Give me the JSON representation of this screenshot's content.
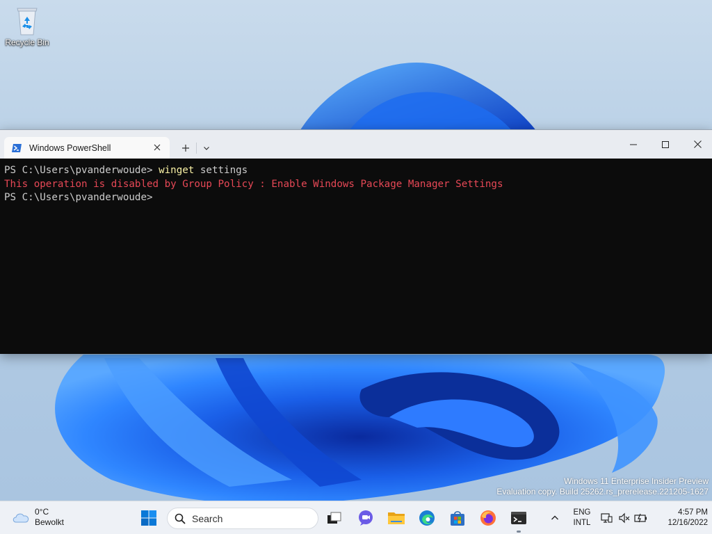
{
  "desktop": {
    "icons": [
      {
        "label": "Recycle Bin",
        "icon": "recycle-bin-icon"
      }
    ]
  },
  "window": {
    "tab_title": "Windows PowerShell",
    "tab_icon": "powershell-icon"
  },
  "console": {
    "lines": [
      {
        "prompt": "PS C:\\Users\\pvanderwoude> ",
        "command": "winget",
        "args": " settings"
      },
      {
        "error": "This operation is disabled by Group Policy : Enable Windows Package Manager Settings"
      },
      {
        "prompt": "PS C:\\Users\\pvanderwoude>"
      }
    ]
  },
  "watermark": {
    "line1": "Windows 11 Enterprise Insider Preview",
    "line2": "Evaluation copy. Build 25262.rs_prerelease.221205-1627"
  },
  "taskbar": {
    "weather": {
      "temp": "0°C",
      "condition": "Bewolkt",
      "icon": "cloud-icon"
    },
    "search_label": "Search",
    "language": {
      "line1": "ENG",
      "line2": "INTL"
    },
    "clock": {
      "time": "4:57 PM",
      "date": "12/16/2022"
    }
  },
  "colors": {
    "accent": "#0067c0",
    "console_bg": "#0c0c0c",
    "console_fg": "#cccccc",
    "command": "#f9f1a5",
    "error": "#e74856"
  }
}
